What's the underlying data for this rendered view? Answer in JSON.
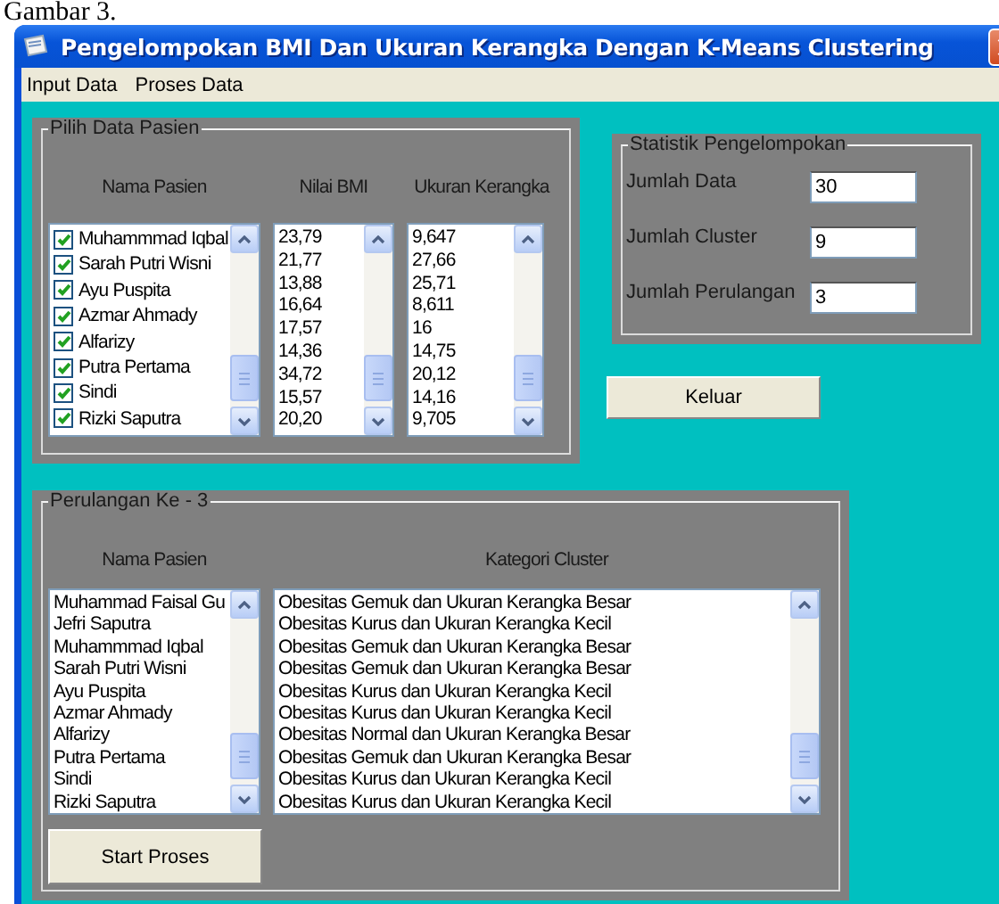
{
  "caption": "Gambar 3.",
  "window": {
    "title": "Pengelompokan BMI Dan Ukuran Kerangka Dengan K-Means Clustering"
  },
  "menu": [
    "Input Data",
    "Proses Data"
  ],
  "pilih_data": {
    "title": "Pilih Data Pasien",
    "headers": [
      "Nama Pasien",
      "Nilai BMI",
      "Ukuran Kerangka"
    ],
    "patients": [
      {
        "name": "Muhammmad Iqbal",
        "checked": true
      },
      {
        "name": "Sarah Putri Wisni",
        "checked": true
      },
      {
        "name": "Ayu Puspita",
        "checked": true
      },
      {
        "name": "Azmar Ahmady",
        "checked": true
      },
      {
        "name": "Alfarizy",
        "checked": true
      },
      {
        "name": "Putra Pertama",
        "checked": true
      },
      {
        "name": "Sindi",
        "checked": true
      },
      {
        "name": "Rizki Saputra",
        "checked": true
      }
    ],
    "bmi": [
      "23,79",
      "21,77",
      "13,88",
      "16,64",
      "17,57",
      "14,36",
      "34,72",
      "15,57",
      "20,20"
    ],
    "ukuran": [
      "9,647",
      "27,66",
      "25,71",
      "8,611",
      "16",
      "14,75",
      "20,12",
      "14,16",
      "9,705"
    ]
  },
  "statistik": {
    "title": "Statistik Pengelompokan",
    "fields": [
      {
        "label": "Jumlah Data",
        "value": "30"
      },
      {
        "label": "Jumlah Cluster",
        "value": "9"
      },
      {
        "label": "Jumlah Perulangan",
        "value": "3"
      }
    ]
  },
  "keluar_button": "Keluar",
  "perulangan": {
    "title": "Perulangan Ke - 3",
    "headers": [
      "Nama Pasien",
      "Kategori Cluster"
    ],
    "names": [
      "Muhammad Faisal Gu",
      "Jefri Saputra",
      "Muhammmad Iqbal",
      "Sarah Putri Wisni",
      "Ayu Puspita",
      "Azmar Ahmady",
      "Alfarizy",
      "Putra Pertama",
      "Sindi",
      "Rizki Saputra"
    ],
    "clusters": [
      "Obesitas Gemuk dan Ukuran Kerangka Besar",
      "Obesitas Kurus dan Ukuran Kerangka Kecil",
      "Obesitas Gemuk dan Ukuran Kerangka Besar",
      "Obesitas Gemuk dan Ukuran Kerangka Besar",
      "Obesitas Kurus dan Ukuran Kerangka Kecil",
      "Obesitas Kurus dan Ukuran Kerangka Kecil",
      "Obesitas Normal dan Ukuran Kerangka Besar",
      "Obesitas Gemuk dan Ukuran Kerangka Besar",
      "Obesitas Kurus dan Ukuran Kerangka Kecil",
      "Obesitas Kurus dan Ukuran Kerangka Kecil"
    ]
  },
  "start_button": "Start Proses"
}
